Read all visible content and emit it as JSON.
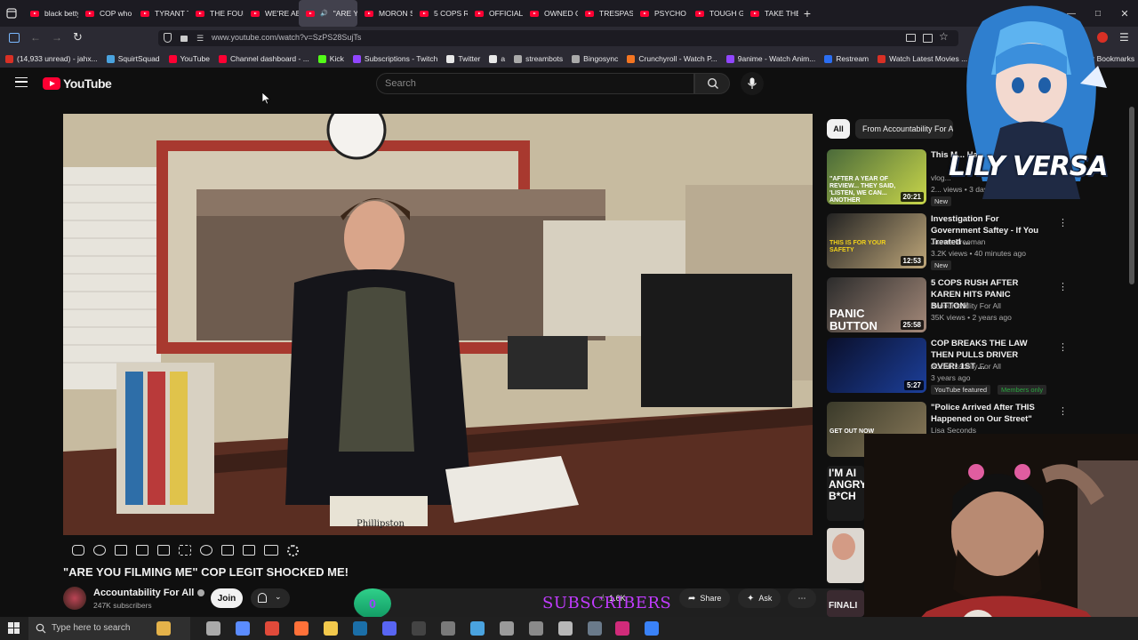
{
  "browser": {
    "tabs": [
      {
        "label": "black betty -",
        "active": false
      },
      {
        "label": "COP who wa",
        "active": false
      },
      {
        "label": "TYRANT TOW",
        "active": false
      },
      {
        "label": "THE FOUR FC",
        "active": false
      },
      {
        "label": "WE'RE ABC",
        "active": false
      },
      {
        "label": "\"ARE Y",
        "active": true
      },
      {
        "label": "MORON STO",
        "active": false
      },
      {
        "label": "5 COPS RUSH",
        "active": false
      },
      {
        "label": "OFFICIAL SHU",
        "active": false
      },
      {
        "label": "OWNED OFF",
        "active": false
      },
      {
        "label": "TRESPASS RE",
        "active": false
      },
      {
        "label": "PSYCHO HAS",
        "active": false
      },
      {
        "label": "TOUGH GUY",
        "active": false
      },
      {
        "label": "TAKE THE",
        "active": false
      }
    ],
    "url": "www.youtube.com/watch?v=SzPS28SujTs",
    "bookmarks": [
      {
        "label": "(14,933 unread) - jahx...",
        "color": "#d93025"
      },
      {
        "label": "SquirtSquad",
        "color": "#4aa3df"
      },
      {
        "label": "YouTube",
        "color": "#ff0033"
      },
      {
        "label": "Channel dashboard - ...",
        "color": "#ff0033"
      },
      {
        "label": "Kick",
        "color": "#53fc18"
      },
      {
        "label": "Subscriptions - Twitch",
        "color": "#9146ff"
      },
      {
        "label": "Twitter",
        "color": "#e8e8e8"
      },
      {
        "label": "a",
        "color": "#e8e8e8"
      },
      {
        "label": "streambots",
        "color": "#aaaaaa"
      },
      {
        "label": "Bingosync",
        "color": "#aaaaaa"
      },
      {
        "label": "Crunchyroll - Watch P...",
        "color": "#f47521"
      },
      {
        "label": "9anime - Watch Anim...",
        "color": "#9146ff"
      },
      {
        "label": "Restream",
        "color": "#2b6ef2"
      },
      {
        "label": "Watch Latest Movies ...",
        "color": "#d93025"
      },
      {
        "label": "/r/Roms Megathrea...",
        "color": "#ff4500"
      }
    ],
    "other_bookmarks": "Other Bookmarks"
  },
  "youtube": {
    "logo_text": "YouTube",
    "search_placeholder": "Search",
    "video_title": "\"ARE YOU FILMING ME\" COP LEGIT SHOCKED ME!",
    "channel_name": "Accountability For All",
    "subscribers": "247K subscribers",
    "join_label": "Join",
    "likes": "1.6K",
    "share_label": "Share",
    "ask_label": "Ask",
    "nameplate": "Phillipston",
    "chips": {
      "all": "All",
      "from": "From Accountability For All"
    },
    "recommendations": [
      {
        "title": "This M... Happ...",
        "channel": "vlog...",
        "meta": "2... views • 3 days ago",
        "badge": "New",
        "duration": "20:21",
        "thumb_text": "\"AFTER A YEAR OF REVIEW... THEY SAID, 'LISTEN, WE CAN... ANOTHER EXPLANATION'\""
      },
      {
        "title": "Investigation For Government Saftey - If You Treated ...",
        "channel": "James Freeman",
        "meta": "3.2K views • 40 minutes ago",
        "badge": "New",
        "duration": "12:53",
        "thumb_text": "THIS IS FOR YOUR SAFETY"
      },
      {
        "title": "5 COPS RUSH AFTER KAREN HITS PANIC BUTTON!",
        "channel": "Accountability For All",
        "meta": "35K views • 2 years ago",
        "badge": "",
        "duration": "25:58",
        "thumb_text": "PANIC BUTTON"
      },
      {
        "title": "COP BREAKS THE LAW THEN PULLS DRIVER OVER! 1ST ...",
        "channel": "Accountability For All",
        "meta": "3 years ago",
        "badge": "YouTube featured",
        "badge2": "Members only",
        "duration": "5:27",
        "thumb_text": ""
      },
      {
        "title": "\"Police Arrived After THIS Happened on Our Street\"",
        "channel": "Lisa Seconds",
        "meta": "",
        "badge": "",
        "duration": "",
        "thumb_text": "GET OUT NOW"
      }
    ],
    "side_thumbs": [
      {
        "text": "I'M AI ANGRY B*CH"
      },
      {
        "text": "FINALI"
      }
    ]
  },
  "overlays": {
    "vtuber_name": "LILY VERSA",
    "sub_count": "0",
    "sub_label": "SUBSCRIBERS"
  },
  "taskbar": {
    "search_placeholder": "Type here to search"
  },
  "colors": {
    "yt_red": "#ff0033",
    "accent_purple": "#c13cff",
    "counter_green": "#2fd08a",
    "members_green": "#2ba640"
  }
}
